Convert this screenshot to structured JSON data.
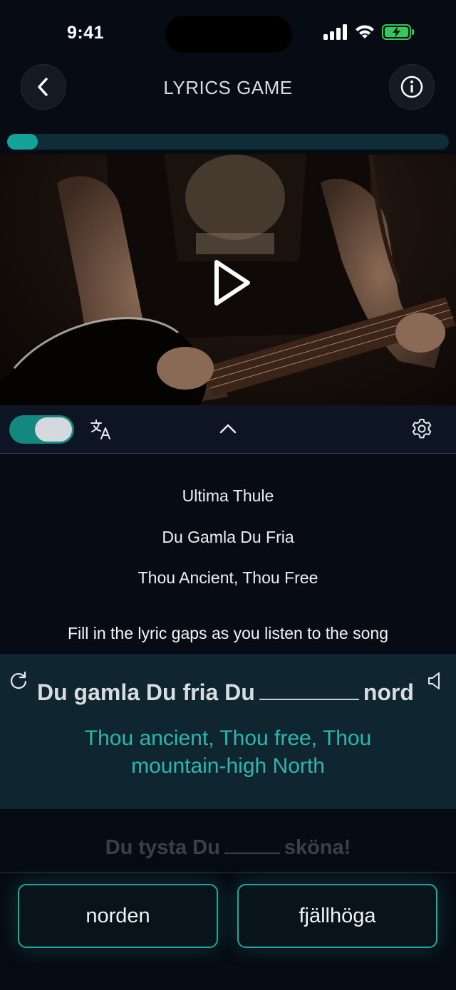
{
  "status_bar": {
    "time": "9:41"
  },
  "header": {
    "title": "LYRICS GAME"
  },
  "progress": {
    "fraction": 0.07,
    "color": "#14a39a"
  },
  "video": {
    "play_icon": "play-icon"
  },
  "controls": {
    "translation_toggle_on": true,
    "icons": [
      "translate-icon",
      "chevron-up-icon",
      "gear-icon"
    ]
  },
  "song": {
    "artist": "Ultima Thule",
    "title": "Du Gamla Du Fria",
    "title_translation": "Thou Ancient, Thou Free"
  },
  "instruction": "Fill in the lyric gaps as you listen to the song",
  "current_lyric": {
    "before_gap": "Du gamla Du fria Du",
    "after_gap": "nord",
    "translation": "Thou ancient, Thou free, Thou mountain-high North"
  },
  "next_lyric": {
    "before_gap": "Du tysta Du",
    "after_gap": "sköna!"
  },
  "answers": [
    "norden",
    "fjällhöga"
  ],
  "colors": {
    "accent": "#1fa79e",
    "translation_text": "#2bb7ad",
    "background": "#070c14"
  }
}
